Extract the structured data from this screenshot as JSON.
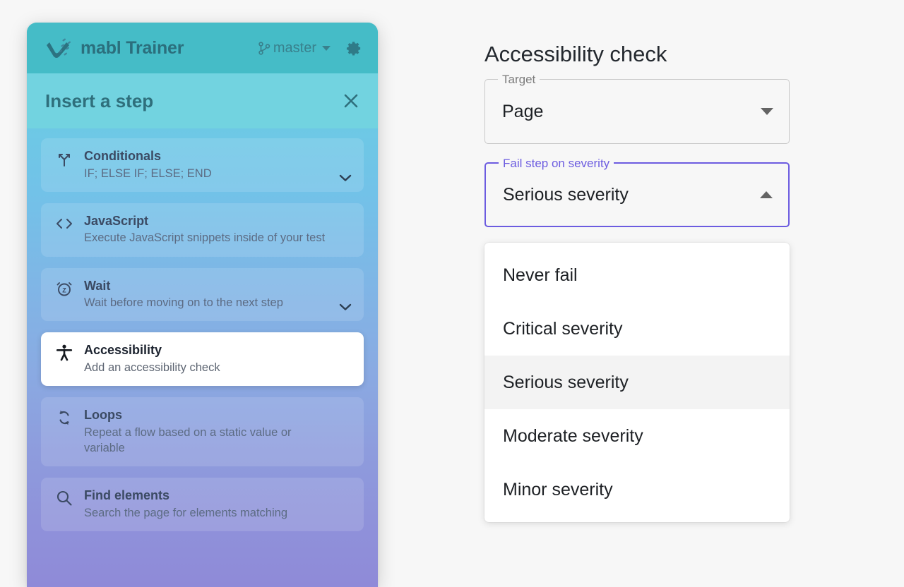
{
  "trainer": {
    "brand_label": "mabl Trainer",
    "brand_logo_icon": "mabl-logo-icon",
    "branch_icon": "git-branch-icon",
    "branch_name": "master",
    "branch_caret_icon": "chevron-down-icon",
    "settings_icon": "gear-icon",
    "panel_title": "Insert a step",
    "close_icon": "close-icon",
    "steps": [
      {
        "name": "Conditionals",
        "desc": "IF; ELSE IF; ELSE; END",
        "icon": "branch-arrows-icon",
        "expandable": true,
        "selected": false
      },
      {
        "name": "JavaScript",
        "desc": "Execute JavaScript snippets inside of your test",
        "icon": "code-brackets-icon",
        "expandable": false,
        "selected": false
      },
      {
        "name": "Wait",
        "desc": "Wait before moving on to the next step",
        "icon": "alarm-clock-icon",
        "expandable": true,
        "selected": false
      },
      {
        "name": "Accessibility",
        "desc": "Add an accessibility check",
        "icon": "accessibility-person-icon",
        "expandable": false,
        "selected": true
      },
      {
        "name": "Loops",
        "desc": "Repeat a flow based on a static value or variable",
        "icon": "loop-arrows-icon",
        "expandable": false,
        "selected": false
      },
      {
        "name": "Find elements",
        "desc": "Search the page for elements matching",
        "icon": "magnifier-icon",
        "expandable": false,
        "selected": false
      }
    ]
  },
  "form": {
    "title": "Accessibility check",
    "target_field": {
      "label": "Target",
      "value": "Page",
      "caret_icon": "caret-down-icon"
    },
    "severity_field": {
      "label": "Fail step on severity",
      "value": "Serious severity",
      "caret_icon": "caret-up-icon",
      "focused": true
    },
    "severity_options": [
      {
        "label": "Never fail",
        "selected": false
      },
      {
        "label": "Critical severity",
        "selected": false
      },
      {
        "label": "Serious severity",
        "selected": true
      },
      {
        "label": "Moderate severity",
        "selected": false
      },
      {
        "label": "Minor severity",
        "selected": false
      }
    ]
  },
  "colors": {
    "accent_purple": "#6c5ce0",
    "header_teal": "#45bcc7",
    "insert_bar_teal": "#72d3e0",
    "panel_gradient_top": "#6ed2e0",
    "panel_gradient_bottom": "#8f8ad8",
    "page_background": "#f7f7f7",
    "option_hover": "#f3f3f3"
  }
}
